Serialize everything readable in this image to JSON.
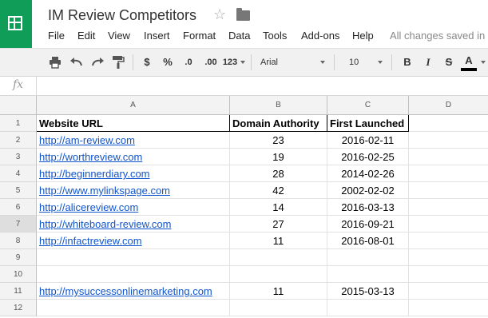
{
  "doc": {
    "title": "IM Review Competitors"
  },
  "menu": [
    "File",
    "Edit",
    "View",
    "Insert",
    "Format",
    "Data",
    "Tools",
    "Add-ons",
    "Help"
  ],
  "status": {
    "saved_text": "All changes saved in Drive"
  },
  "toolbar": {
    "currency": "$",
    "percent": "%",
    "dec_decrease": ".0",
    "dec_increase": ".00",
    "more_formats": "123",
    "font": "Arial",
    "size": "10",
    "bold": "B",
    "italic": "I",
    "strike": "S",
    "text_color": "A",
    "text_color_value": "#000000"
  },
  "formula_bar": {
    "fx": "fx",
    "value": ""
  },
  "grid": {
    "columns": [
      "A",
      "B",
      "C",
      "D"
    ],
    "headers": [
      "Website URL",
      "Domain Authority",
      "First Launched"
    ],
    "rows": [
      {
        "n": "1"
      },
      {
        "n": "2",
        "url": "http://am-review.com",
        "da": "23",
        "date": "2016-02-11"
      },
      {
        "n": "3",
        "url": "http://worthreview.com",
        "da": "19",
        "date": "2016-02-25"
      },
      {
        "n": "4",
        "url": "http://beginnerdiary.com",
        "da": "28",
        "date": "2014-02-26"
      },
      {
        "n": "5",
        "url": "http://www.mylinkspage.com",
        "da": "42",
        "date": "2002-02-02"
      },
      {
        "n": "6",
        "url": "http://alicereview.com",
        "da": "14",
        "date": "2016-03-13"
      },
      {
        "n": "7",
        "url": "http://whiteboard-review.com",
        "da": "27",
        "date": "2016-09-21"
      },
      {
        "n": "8",
        "url": "http://infactreview.com",
        "da": "11",
        "date": "2016-08-01"
      },
      {
        "n": "9"
      },
      {
        "n": "10"
      },
      {
        "n": "11",
        "url": "http://mysuccessonlinemarketing.com",
        "da": "11",
        "date": "2015-03-13"
      },
      {
        "n": "12"
      }
    ]
  },
  "colors": {
    "brand": "#0f9d58",
    "link": "#1155cc"
  }
}
